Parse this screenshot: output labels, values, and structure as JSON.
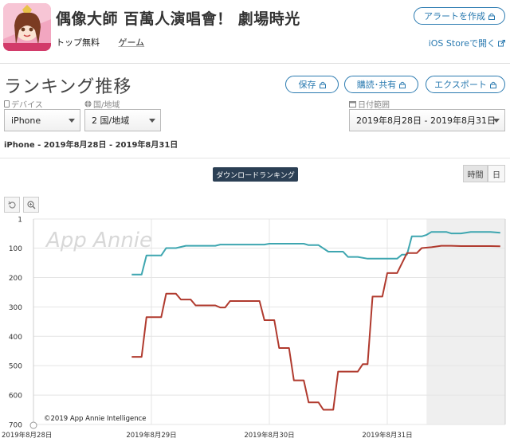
{
  "app": {
    "title": "偶像大師 百萬人演唱會！ 劇場時光",
    "category": "トップ無料",
    "genre": "ゲーム",
    "alert_button": "アラートを作成",
    "ios_link": "iOS Storeで開く"
  },
  "section": {
    "title": "ランキング推移",
    "save_button": "保存",
    "subscribe_button": "購読･共有",
    "export_button": "エクスポート"
  },
  "filters": {
    "device_label": "デバイス",
    "device_value": "iPhone",
    "country_label": "国/地域",
    "country_value": "2 国/地域",
    "date_label": "日付範囲",
    "date_value": "2019年8月28日 - 2019年8月31日"
  },
  "range_text": "iPhone - 2019年8月28日 - 2019年8月31日",
  "chart_controls": {
    "ranking_badge": "ダウンロードランキング",
    "hour_toggle": "時間",
    "day_toggle": "日"
  },
  "colors": {
    "accent": "#2a7ab0",
    "series_teal": "#3ea6b0",
    "series_red": "#b03a2e",
    "future_shade": "#efefef"
  },
  "chart_data": {
    "type": "line",
    "watermark": "App Annie",
    "copyright": "©2019 App Annie Intelligence",
    "y_ticks": [
      "1",
      "100",
      "200",
      "300",
      "400",
      "500",
      "600",
      "700"
    ],
    "y_values": [
      1,
      100,
      200,
      300,
      400,
      500,
      600,
      700
    ],
    "ylim": [
      1,
      700
    ],
    "y_inverted": true,
    "x_ticks": [
      "2019年8月28日",
      "2019年8月29日",
      "2019年8月30日",
      "2019年8月31日"
    ],
    "x_hours_range": [
      0,
      96
    ],
    "shaded_from_hour": 80,
    "grid": true,
    "series": [
      {
        "color": "#3ea6b0",
        "points": [
          [
            20,
            190
          ],
          [
            22,
            190
          ],
          [
            23,
            125
          ],
          [
            26,
            125
          ],
          [
            27,
            100
          ],
          [
            29,
            100
          ],
          [
            31,
            92
          ],
          [
            37,
            92
          ],
          [
            38,
            88
          ],
          [
            47,
            88
          ],
          [
            48,
            85
          ],
          [
            55,
            85
          ],
          [
            56,
            90
          ],
          [
            58,
            90
          ],
          [
            60,
            112
          ],
          [
            63,
            112
          ],
          [
            64,
            130
          ],
          [
            66,
            130
          ],
          [
            68,
            136
          ],
          [
            74,
            136
          ],
          [
            75,
            122
          ],
          [
            76,
            122
          ],
          [
            77,
            60
          ],
          [
            79,
            60
          ],
          [
            80,
            55
          ],
          [
            81,
            45
          ],
          [
            84,
            45
          ],
          [
            85,
            50
          ],
          [
            87,
            50
          ],
          [
            89,
            45
          ],
          [
            93,
            45
          ],
          [
            95,
            48
          ]
        ]
      },
      {
        "color": "#b03a2e",
        "points": [
          [
            20,
            470
          ],
          [
            22,
            470
          ],
          [
            23,
            335
          ],
          [
            26,
            335
          ],
          [
            27,
            255
          ],
          [
            29,
            255
          ],
          [
            30,
            275
          ],
          [
            32,
            275
          ],
          [
            33,
            295
          ],
          [
            37,
            295
          ],
          [
            38,
            302
          ],
          [
            39,
            302
          ],
          [
            40,
            280
          ],
          [
            46,
            280
          ],
          [
            47,
            345
          ],
          [
            49,
            345
          ],
          [
            50,
            440
          ],
          [
            52,
            440
          ],
          [
            53,
            550
          ],
          [
            55,
            550
          ],
          [
            56,
            625
          ],
          [
            58,
            625
          ],
          [
            59,
            650
          ],
          [
            61,
            650
          ],
          [
            62,
            520
          ],
          [
            64,
            520
          ],
          [
            66,
            520
          ],
          [
            67,
            495
          ],
          [
            68,
            495
          ],
          [
            69,
            265
          ],
          [
            71,
            265
          ],
          [
            72,
            185
          ],
          [
            74,
            185
          ],
          [
            76,
            117
          ],
          [
            78,
            117
          ],
          [
            79,
            100
          ],
          [
            81,
            97
          ],
          [
            83,
            92
          ],
          [
            85,
            92
          ],
          [
            87,
            93
          ],
          [
            93,
            93
          ],
          [
            95,
            94
          ]
        ]
      }
    ]
  }
}
